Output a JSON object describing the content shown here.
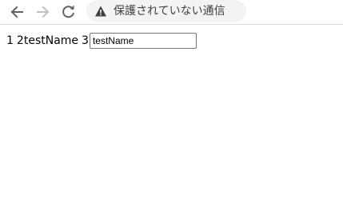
{
  "browser": {
    "back_icon": "arrow-left-icon",
    "forward_icon": "arrow-right-icon",
    "reload_icon": "reload-icon",
    "security_icon": "warning-triangle-icon",
    "security_text": "保護されていない通信",
    "colors": {
      "icon_active": "#5f6368",
      "icon_disabled": "#bdc1c6",
      "omnibox_bg": "#f1f3f4"
    }
  },
  "page": {
    "text_1": "1",
    "text_2": "2",
    "name_text": "testName",
    "text_3": "3",
    "name_input_value": "testName"
  }
}
